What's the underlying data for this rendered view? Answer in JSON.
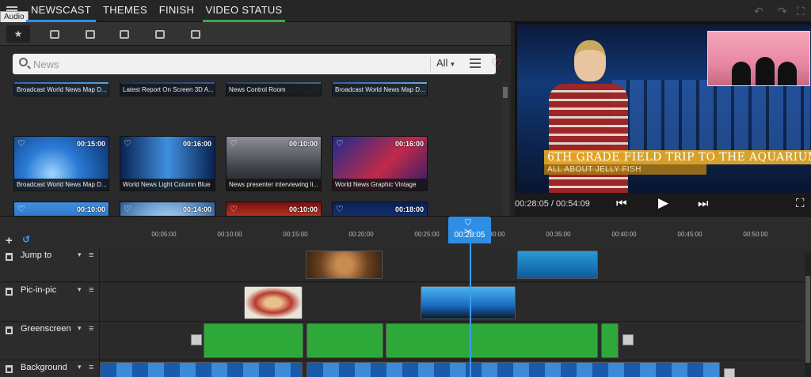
{
  "topbar": {
    "tooltip": "Audio",
    "tabs": [
      {
        "label": "NEWSCAST",
        "state": "active"
      },
      {
        "label": "THEMES",
        "state": ""
      },
      {
        "label": "FINISH",
        "state": ""
      },
      {
        "label": "VIDEO STATUS",
        "state": "highlight"
      }
    ],
    "undo_icon": "undo-icon",
    "redo_icon": "redo-icon",
    "fullscreen_icon": "fullscreen-icon"
  },
  "library": {
    "categories": [
      "favorites-star-icon",
      "folder-add-icon",
      "text-icon",
      "music-icon",
      "image-icon",
      "gallery-icon"
    ],
    "search": {
      "placeholder": "News",
      "value": ""
    },
    "filter": {
      "selected": "All",
      "caret": "▾"
    },
    "heart": "♡",
    "star": "★",
    "rows": [
      [
        {
          "caption": "Broadcast World News Map D...",
          "duration": ""
        },
        {
          "caption": "Latest Report On Screen 3D A...",
          "duration": ""
        },
        {
          "caption": "News Control Room",
          "duration": ""
        },
        {
          "caption": "Broadcast World News Map D...",
          "duration": ""
        }
      ],
      [
        {
          "caption": "Broadcast World News Map D...",
          "duration": "00:15:00"
        },
        {
          "caption": "World News Light Column Blue",
          "duration": "00:16:00"
        },
        {
          "caption": "News presenter interviewing li...",
          "duration": "00:10:00"
        },
        {
          "caption": "World News Graphic Vintage",
          "duration": "00:16:00"
        }
      ],
      [
        {
          "caption": "",
          "duration": "00:10:00"
        },
        {
          "caption": "",
          "duration": "00:14:00"
        },
        {
          "caption": "",
          "duration": "00:10:00"
        },
        {
          "caption": "",
          "duration": "00:18:00"
        }
      ]
    ]
  },
  "preview": {
    "title": "6TH GRADE FIELD TRIP TO THE AQUARIUM",
    "subtitle": "ALL ABOUT JELLY FISH",
    "timecode": "00:28:05 / 00:54:09",
    "prev_glyph": "⏮",
    "play_glyph": "▶",
    "next_glyph": "⏭",
    "fullscreen_glyph": "⛶"
  },
  "timeline": {
    "add": "+",
    "undo": "↺",
    "ticks": [
      "00:05:00",
      "00:10:00",
      "00:15:00",
      "00:20:00",
      "00:25:00",
      "00:30:00",
      "00:35:00",
      "00:40:00",
      "00:45:00",
      "00:50:00"
    ],
    "playhead": {
      "time": "00:28:05",
      "marker_glyph": "⛉",
      "split_glyph": "✂"
    },
    "tracks": [
      {
        "name": "Jump to",
        "caret": "▾",
        "menu": "≡"
      },
      {
        "name": "Pic-in-pic",
        "caret": "▾",
        "menu": "≡"
      },
      {
        "name": "Greenscreen",
        "caret": "▾",
        "menu": "≡"
      },
      {
        "name": "Background",
        "caret": "▾",
        "menu": "≡"
      }
    ]
  },
  "colors": {
    "accent_blue": "#2e8ee6",
    "accent_green": "#3aa84a",
    "favorite_red": "#e05a5a"
  }
}
